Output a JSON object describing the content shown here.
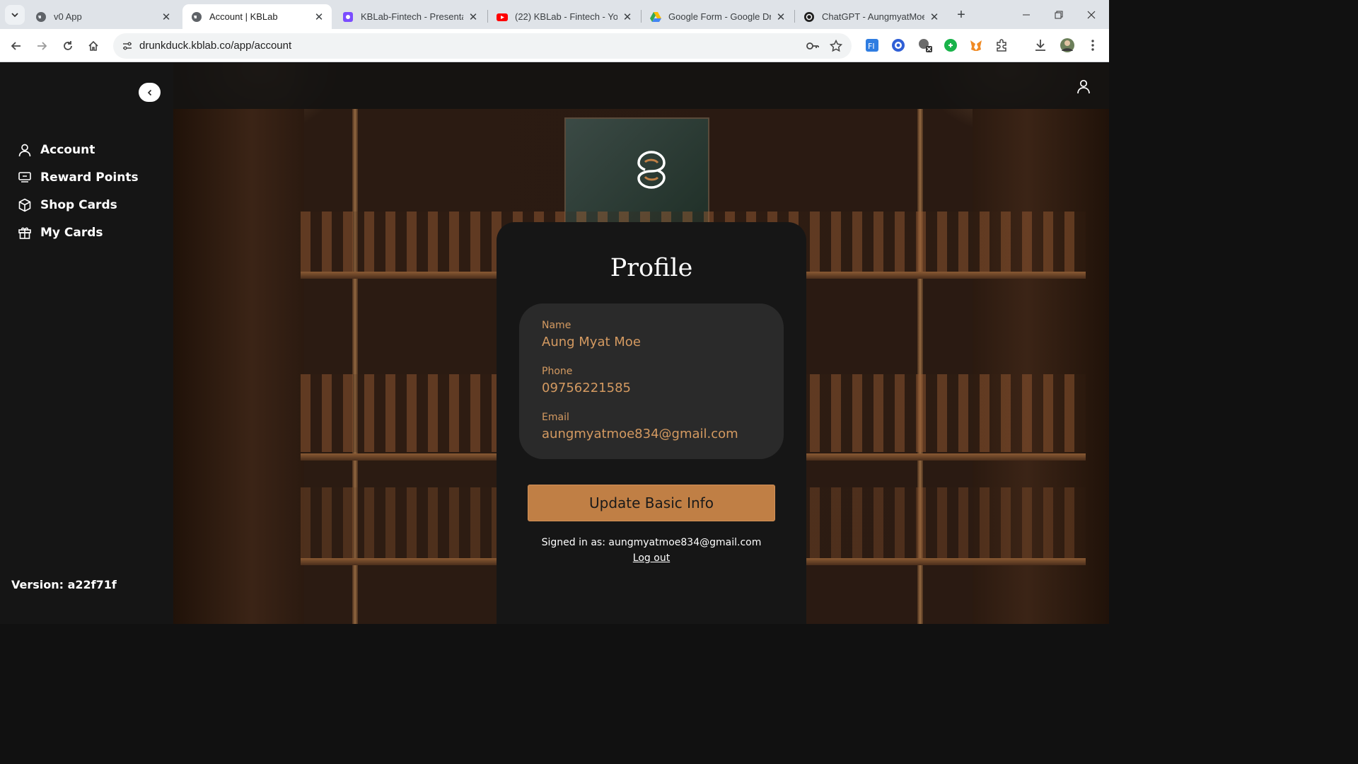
{
  "browser": {
    "tabs": [
      {
        "title": "v0 App",
        "icon": "globe-icon",
        "active": false
      },
      {
        "title": "Account | KBLab",
        "icon": "globe-icon",
        "active": true
      },
      {
        "title": "KBLab-Fintech - Presentati",
        "icon": "canva-icon",
        "active": false
      },
      {
        "title": "(22) KBLab - Fintech - YouT",
        "icon": "youtube-icon",
        "active": false
      },
      {
        "title": "Google Form - Google Driv",
        "icon": "google-drive-icon",
        "active": false
      },
      {
        "title": "ChatGPT - AungmyatMoe(",
        "icon": "chatgpt-icon",
        "active": false
      }
    ],
    "url": "drunkduck.kblab.co/app/account"
  },
  "sidebar": {
    "items": [
      {
        "label": "Account",
        "icon": "user-icon"
      },
      {
        "label": "Reward Points",
        "icon": "reward-icon"
      },
      {
        "label": "Shop Cards",
        "icon": "box-icon"
      },
      {
        "label": "My Cards",
        "icon": "gift-icon"
      }
    ],
    "version": "Version: a22f71f"
  },
  "profile": {
    "title": "Profile",
    "fields": [
      {
        "label": "Name",
        "value": "Aung Myat Moe"
      },
      {
        "label": "Phone",
        "value": "09756221585"
      },
      {
        "label": "Email",
        "value": "aungmyatmoe834@gmail.com"
      }
    ],
    "update_button": "Update Basic Info",
    "signed_in": "Signed in as: aungmyatmoe834@gmail.com",
    "logout": "Log out"
  },
  "colors": {
    "accent": "#c07f45",
    "field_text": "#d49a61",
    "card_bg": "#161616",
    "sidebar_bg": "#151515"
  }
}
